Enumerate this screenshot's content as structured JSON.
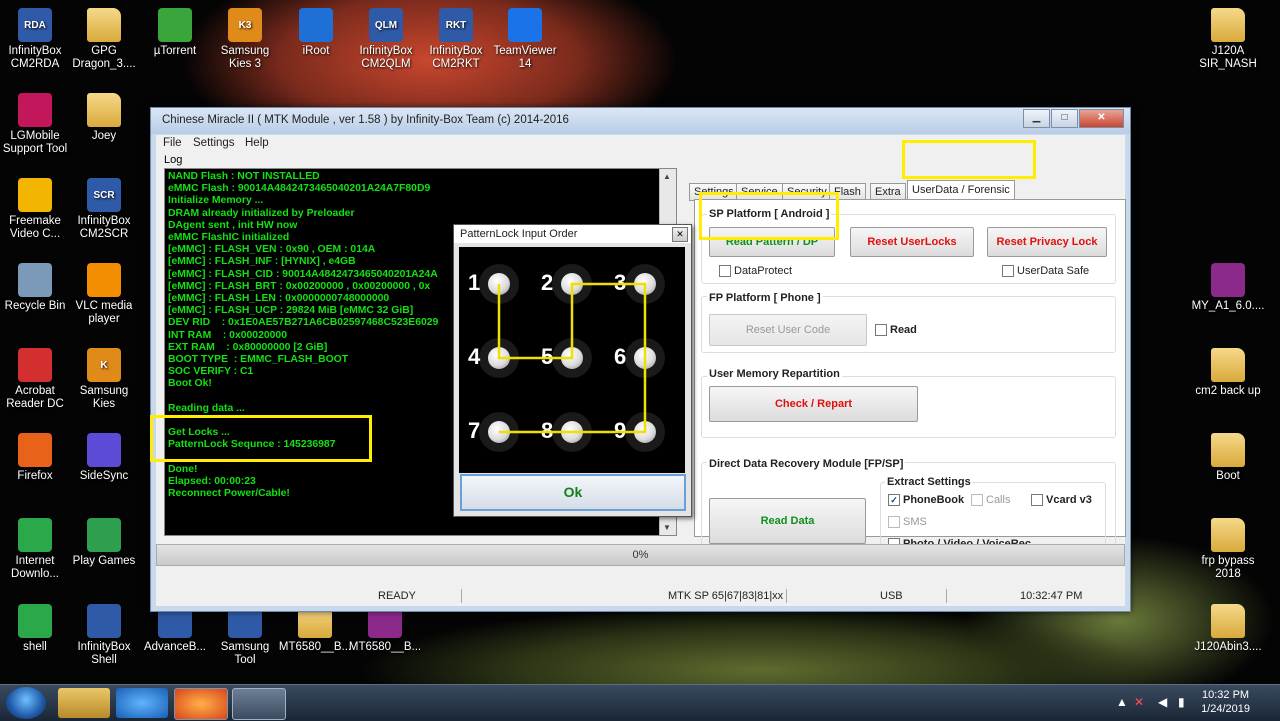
{
  "desktop_icons": [
    {
      "label": "InfinityBox\nCM2RDA",
      "badge": "RDA",
      "color": "#2f5aa8"
    },
    {
      "label": "GPG\nDragon_3....",
      "color": "folder"
    },
    {
      "label": "µTorrent",
      "color": "#3aa53a"
    },
    {
      "label": "Samsung\nKies 3",
      "badge": "K3",
      "color": "#e08a1a"
    },
    {
      "label": "iRoot",
      "color": "#1e6fd6"
    },
    {
      "label": "InfinityBox\nCM2QLM",
      "badge": "QLM",
      "color": "#2f5aa8"
    },
    {
      "label": "InfinityBox\nCM2RKT",
      "badge": "RKT",
      "color": "#2f5aa8"
    },
    {
      "label": "TeamViewer\n14",
      "color": "#1a73e8"
    },
    {
      "label": "J120A\nSIR_NASH",
      "color": "folder"
    },
    {
      "label": "LGMobile\nSupport Tool",
      "color": "#c2185b"
    },
    {
      "label": "Joey",
      "color": "folder"
    },
    {
      "label": "Freemake\nVideo C...",
      "color": "#f2b600"
    },
    {
      "label": "InfinityBox\nCM2SCR",
      "badge": "SCR",
      "color": "#2f5aa8"
    },
    {
      "label": "Recycle Bin",
      "color": "#7a9ab8"
    },
    {
      "label": "VLC media\nplayer",
      "color": "#f28c00"
    },
    {
      "label": "MY_A1_6.0....",
      "color": "#8b2a8b"
    },
    {
      "label": "Acrobat\nReader DC",
      "color": "#d32f2f"
    },
    {
      "label": "Samsung\nKies",
      "badge": "K",
      "color": "#e08a1a"
    },
    {
      "label": "cm2 back up",
      "color": "folder"
    },
    {
      "label": "Firefox",
      "color": "#e8621a"
    },
    {
      "label": "SideSync",
      "color": "#5b4bd6"
    },
    {
      "label": "Boot",
      "color": "folder"
    },
    {
      "label": "Internet\nDownlo...",
      "color": "#2aa84a"
    },
    {
      "label": "Play Games",
      "color": "#2e9e4f"
    },
    {
      "label": "frp bypass\n2018",
      "color": "folder"
    },
    {
      "label": "shell",
      "color": "#2aa84a"
    },
    {
      "label": "InfinityBox\nShell",
      "color": "#2f5aa8"
    },
    {
      "label": "AdvanceB...",
      "color": "#2f5aa8"
    },
    {
      "label": "Samsung\nTool",
      "color": "#2f5aa8"
    },
    {
      "label": "MT6580__B...",
      "color": "folder"
    },
    {
      "label": "MT6580__B...",
      "color": "#8b2a8b"
    },
    {
      "label": "J120Abin3....",
      "color": "folder"
    }
  ],
  "window": {
    "title": "Chinese Miracle II ( MTK Module , ver 1.58 ) by Infinity-Box Team (c) 2014-2016",
    "controls": {
      "minimize": "▁",
      "maximize": "□",
      "close": "✕"
    },
    "menu": [
      "File",
      "Settings",
      "Help"
    ],
    "log_label": "Log",
    "log_lines": [
      "NAND Flash : NOT INSTALLED",
      "eMMC Flash : 90014A4842473465040201A24A7F80D9",
      "Initialize Memory ...",
      "DRAM already initialized by Preloader",
      "DAgent sent , init HW now",
      "eMMC FlashIC initialized",
      "[eMMC] : FLASH_VEN : 0x90 , OEM : 014A",
      "[eMMC] : FLASH_INF : [HYNIX] , e4GB",
      "[eMMC] : FLASH_CID : 90014A4842473465040201A24A",
      "[eMMC] : FLASH_BRT : 0x00200000 , 0x00200000 , 0x",
      "[eMMC] : FLASH_LEN : 0x0000000748000000",
      "[eMMC] : FLASH_UCP : 29824 MiB [eMMC 32 GiB]",
      "DEV RID    : 0x1E0AE57B271A6CB02597468C523E6029",
      "INT RAM    : 0x00020000",
      "EXT RAM    : 0x80000000 [2 GiB]",
      "BOOT TYPE  : EMMC_FLASH_BOOT",
      "SOC VERIFY : C1",
      "Boot Ok!",
      "",
      "Reading data ...",
      "",
      "Get Locks ...",
      "PatternLock Sequnce : 145236987",
      "",
      "Done!",
      "Elapsed: 00:00:23",
      "Reconnect Power/Cable!"
    ],
    "progress": "0%",
    "status": {
      "state": "READY",
      "chip": "MTK SP 65|67|83|81|xx",
      "port": "USB",
      "time": "10:32:47 PM"
    },
    "tabs": [
      "Settings",
      "Service",
      "Security",
      "Flash",
      "Extra",
      "UserData / Forensic"
    ],
    "active_tab": "UserData / Forensic",
    "sp_platform": {
      "label": "SP Platform [ Android ]",
      "read_pattern": "Read Pattern / DP",
      "reset_userlocks": "Reset UserLocks",
      "reset_privacy": "Reset Privacy Lock",
      "dataprotect": "DataProtect",
      "userdata_safe": "UserData Safe"
    },
    "fp_platform": {
      "label": "FP Platform [ Phone ]",
      "reset_user_code": "Reset User Code",
      "read": "Read"
    },
    "repartition": {
      "label": "User Memory Repartition",
      "check_repart": "Check / Repart"
    },
    "recovery": {
      "label": "Direct Data Recovery Module  [FP/SP]",
      "read_data": "Read Data",
      "extract_label": "Extract Settings",
      "phonebook": "PhoneBook",
      "calls": "Calls",
      "vcard": "Vcard v3",
      "sms": "SMS",
      "photo": "Photo / Video / VoiceRec"
    }
  },
  "dialog": {
    "title": "PatternLock Input Order",
    "close": "✕",
    "numbers": [
      "1",
      "2",
      "3",
      "4",
      "5",
      "6",
      "7",
      "8",
      "9"
    ],
    "sequence": [
      1,
      4,
      5,
      2,
      3,
      6,
      9,
      8,
      7
    ],
    "ok": "Ok"
  },
  "taskbar": {
    "time": "10:32 PM",
    "date": "1/24/2019"
  },
  "colors": {
    "log_text": "#14e014",
    "highlight": "#ffee00",
    "pattern_line": "#f0e000"
  }
}
